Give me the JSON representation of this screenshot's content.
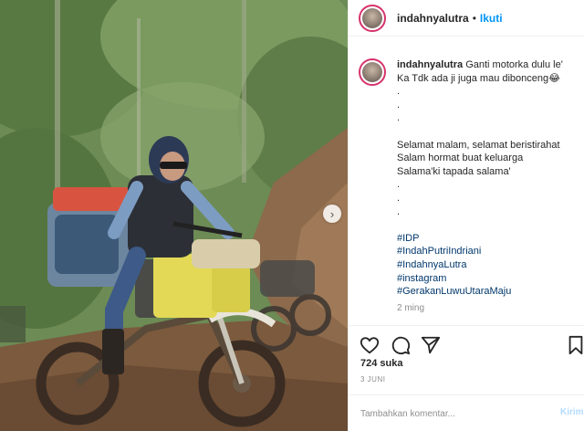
{
  "post": {
    "username": "indahnyalutra",
    "separator": "•",
    "follow_label": "Ikuti"
  },
  "caption": {
    "username": "indahnyalutra",
    "lines": [
      "Ganti motorka dulu le'",
      "Ka Tdk ada ji juga mau dibonceng😂",
      ".",
      ".",
      ".",
      "",
      "Selamat malam, selamat beristirahat",
      "Salam hormat buat keluarga",
      "Salama'ki tapada salama'",
      ".",
      ".",
      ".",
      ""
    ],
    "hashtags": [
      "#IDP",
      "#IndahPutriIndriani",
      "#IndahnyaLutra",
      "#instagram",
      "#GerakanLuwuUtaraMaju"
    ],
    "time_ago": "2 ming"
  },
  "stats": {
    "likes": "724 suka",
    "date": "3 JUNI"
  },
  "comment": {
    "placeholder": "Tambahkan komentar...",
    "post_label": "Kirim"
  },
  "photo": {
    "next_icon": "›"
  },
  "colors": {
    "accent_blue": "#0095f6",
    "story_ring": "#d6336c",
    "post_disabled": "#b3dbff"
  },
  "icons": [
    "heart-icon",
    "comment-icon",
    "share-icon",
    "bookmark-icon",
    "chevron-right-icon"
  ]
}
